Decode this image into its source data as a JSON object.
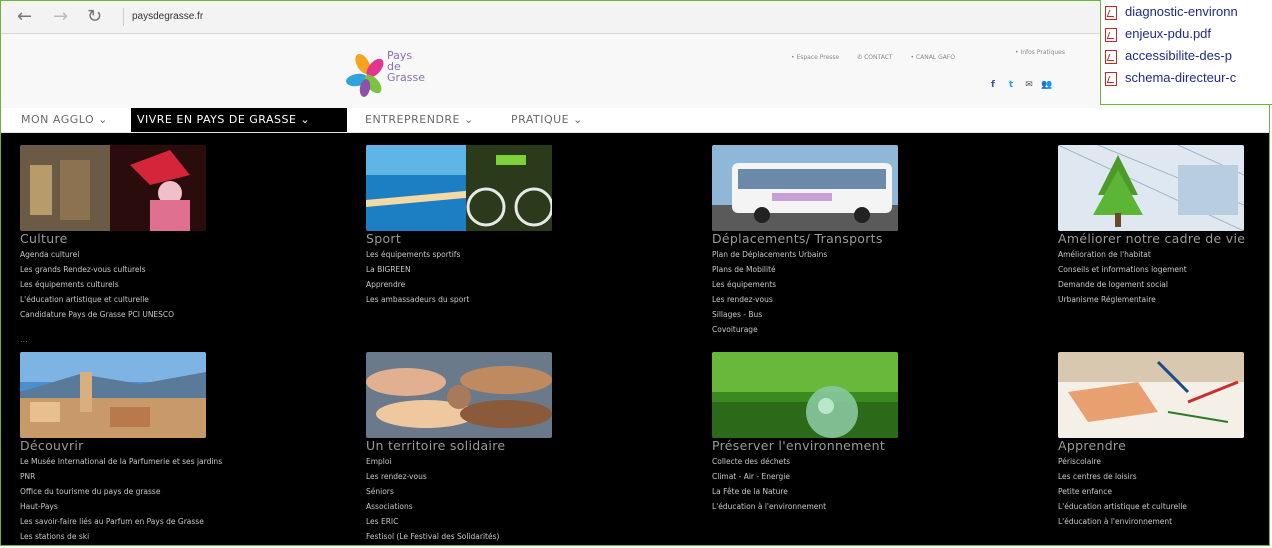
{
  "browser": {
    "url": "paysdegrasse.fr",
    "back_icon": "←",
    "forward_icon": "→",
    "reload_icon": "↻"
  },
  "site": {
    "logo_line1": "Pays",
    "logo_line2": "de",
    "logo_line3": "Grasse",
    "top_links": [
      "• Espace Presse",
      "✆ CONTACT",
      "• CANAL GAFO",
      "• Infos Pratiques"
    ],
    "social_icons": [
      "f",
      "t",
      "✉",
      "👥"
    ]
  },
  "nav": {
    "items": [
      "MON AGGLO ⌄",
      "VIVRE EN PAYS DE GRASSE ⌄",
      "ENTREPRENDRE ⌄",
      "PRATIQUE ⌄"
    ]
  },
  "menu": {
    "row1": [
      {
        "title": "Culture",
        "image": "museum-photo",
        "links": [
          "Agenda culturel",
          "Les grands Rendez-vous culturels",
          "Les équipements culturels",
          "L'éducation artistique et culturelle",
          "Candidature Pays de Grasse PCI UNESCO"
        ]
      },
      {
        "title": "Sport",
        "image": "swimming-cycling-photo",
        "links": [
          "Les équipements sportifs",
          "La BIGREEN",
          "Apprendre",
          "Les ambassadeurs du sport"
        ]
      },
      {
        "title": "Déplacements/ Transports",
        "image": "bus-photo",
        "links": [
          "Plan de Déplacements Urbains",
          "Plans de Mobilité",
          "Les équipements",
          "Les rendez-vous",
          "Sillages - Bus",
          "Covoiturage"
        ]
      },
      {
        "title": "Améliorer notre cadre de vie",
        "image": "tree-blueprint-photo",
        "links": [
          "Amélioration de l'habitat",
          "Conseils et informations logement",
          "Demande de logement social",
          "Urbanisme Réglementaire"
        ]
      }
    ],
    "ellipsis": "...",
    "row2": [
      {
        "title": "Découvrir",
        "image": "grasse-town-photo",
        "links": [
          "Le Musée International de la Parfumerie et ses jardins",
          "PNR",
          "Office du tourisme du pays de grasse",
          "Haut-Pays",
          "Les savoir-faire liés au Parfum en Pays de Grasse",
          "Les stations de ski"
        ]
      },
      {
        "title": "Un territoire solidaire",
        "image": "hands-photo",
        "links": [
          "Emploi",
          "Les rendez-vous",
          "Séniors",
          "Associations",
          "Les ERIC",
          "Festisol (Le Festival des Solidarités)"
        ]
      },
      {
        "title": "Préserver l'environnement",
        "image": "grass-globe-photo",
        "links": [
          "Collecte des déchets",
          "Climat - Air - Energie",
          "La Fête de la Nature",
          "L'éducation à l'environnement"
        ]
      },
      {
        "title": "Apprendre",
        "image": "child-drawing-photo",
        "links": [
          "Périscolaire",
          "Les centres de loisirs",
          "Petite enfance",
          "L'éducation artistique et culturelle",
          "L'éducation à l'environnement"
        ]
      }
    ]
  },
  "pdf_files": [
    "diagnostic-environn",
    "enjeux-pdu.pdf",
    "accessibilite-des-p",
    "schema-directeur-c"
  ]
}
